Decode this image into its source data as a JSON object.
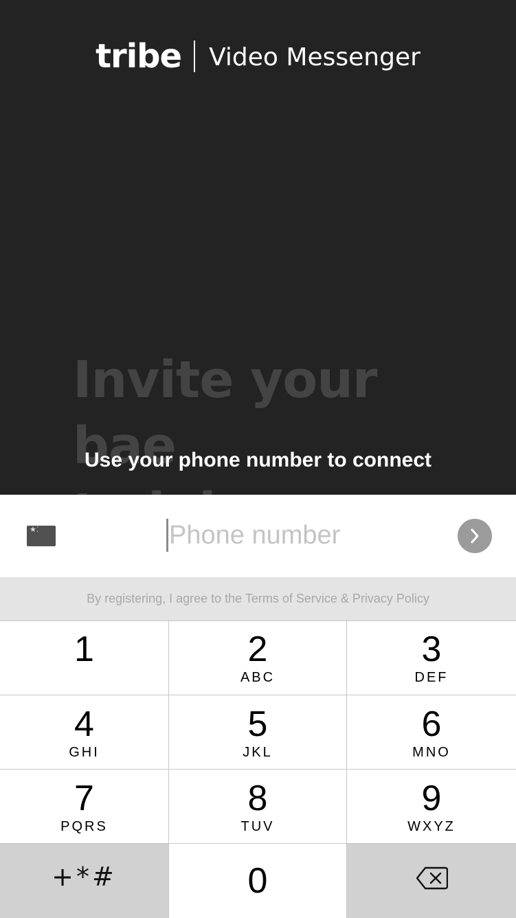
{
  "header": {
    "brand": "tribe",
    "title": "Video Messenger"
  },
  "promo": {
    "lines": [
      "Invite your",
      "bae",
      "to join"
    ]
  },
  "connect_text": "Use your phone number to connect",
  "phone": {
    "country_flag": "china-flag",
    "placeholder": "Phone number",
    "value": ""
  },
  "terms": "By registering, I agree to the Terms of Service & Privacy Policy",
  "keypad": {
    "keys": [
      {
        "digit": "1",
        "letters": ""
      },
      {
        "digit": "2",
        "letters": "ABC"
      },
      {
        "digit": "3",
        "letters": "DEF"
      },
      {
        "digit": "4",
        "letters": "GHI"
      },
      {
        "digit": "5",
        "letters": "JKL"
      },
      {
        "digit": "6",
        "letters": "MNO"
      },
      {
        "digit": "7",
        "letters": "PQRS"
      },
      {
        "digit": "8",
        "letters": "TUV"
      },
      {
        "digit": "9",
        "letters": "WXYZ"
      }
    ],
    "symbols": "+*#",
    "zero": "0",
    "backspace_icon": "backspace-icon"
  },
  "colors": {
    "background": "#232323",
    "key_dark": "#d1d1d1",
    "next_button": "#9b9b9b"
  }
}
